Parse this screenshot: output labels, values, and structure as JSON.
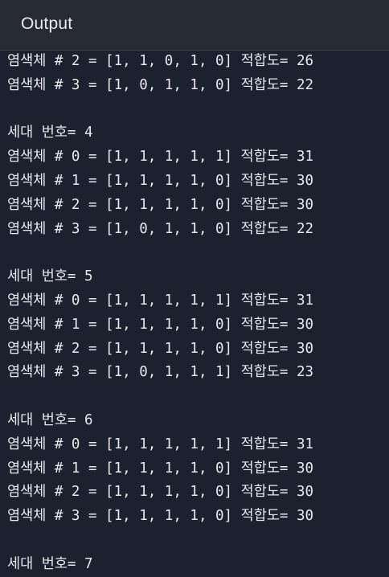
{
  "header": {
    "title": "Output"
  },
  "console": {
    "lines": [
      "염색체 # 2 = [1, 1, 0, 1, 0] 적합도= 26",
      "염색체 # 3 = [1, 0, 1, 1, 0] 적합도= 22",
      "",
      "세대 번호= 4",
      "염색체 # 0 = [1, 1, 1, 1, 1] 적합도= 31",
      "염색체 # 1 = [1, 1, 1, 1, 0] 적합도= 30",
      "염색체 # 2 = [1, 1, 1, 1, 0] 적합도= 30",
      "염색체 # 3 = [1, 0, 1, 1, 0] 적합도= 22",
      "",
      "세대 번호= 5",
      "염색체 # 0 = [1, 1, 1, 1, 1] 적합도= 31",
      "염색체 # 1 = [1, 1, 1, 1, 0] 적합도= 30",
      "염색체 # 2 = [1, 1, 1, 1, 0] 적합도= 30",
      "염색체 # 3 = [1, 0, 1, 1, 1] 적합도= 23",
      "",
      "세대 번호= 6",
      "염색체 # 0 = [1, 1, 1, 1, 1] 적합도= 31",
      "염색체 # 1 = [1, 1, 1, 1, 0] 적합도= 30",
      "염색체 # 2 = [1, 1, 1, 1, 0] 적합도= 30",
      "염색체 # 3 = [1, 1, 1, 1, 0] 적합도= 30",
      "",
      "세대 번호= 7"
    ]
  },
  "colors": {
    "background": "#1c2130",
    "header_background": "#262a33",
    "text": "#e6e8ec"
  }
}
